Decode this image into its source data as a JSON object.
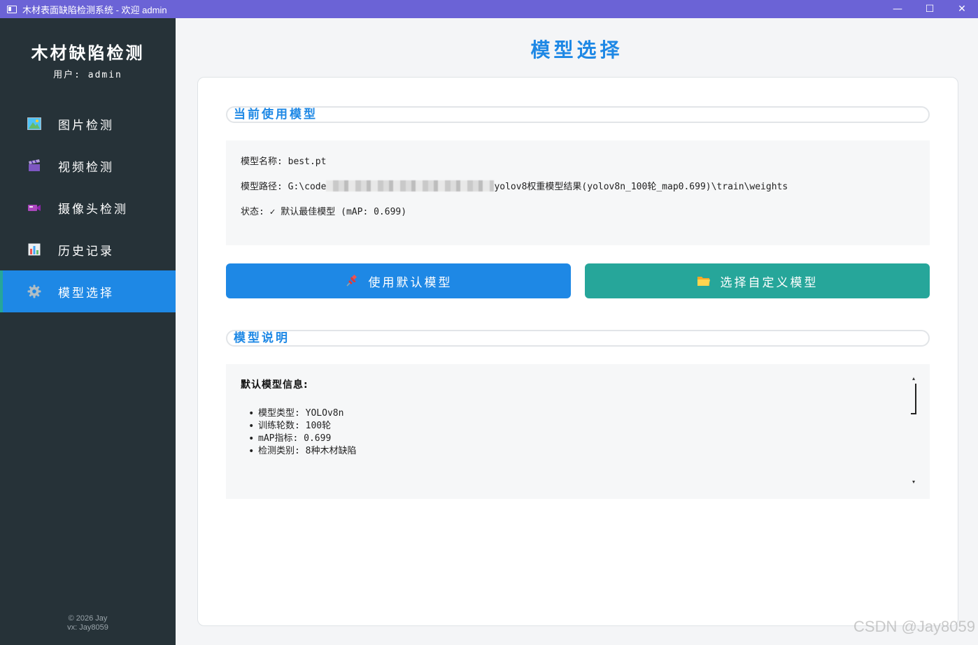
{
  "window": {
    "title": "木材表面缺陷检测系统 - 欢迎 admin",
    "minimize": "—",
    "maximize": "☐",
    "close": "✕"
  },
  "sidebar": {
    "brand": "木材缺陷检测",
    "user": "用户: admin",
    "items": [
      {
        "label": "图片检测",
        "icon": "image-icon"
      },
      {
        "label": "视频检测",
        "icon": "clapperboard-icon"
      },
      {
        "label": "摄像头检测",
        "icon": "video-camera-icon"
      },
      {
        "label": "历史记录",
        "icon": "bar-chart-icon"
      },
      {
        "label": "模型选择",
        "icon": "gear-icon",
        "active": true
      }
    ],
    "footer_line1": "© 2026 Jay",
    "footer_line2": "vx: Jay8059"
  },
  "main": {
    "page_title": "模型选择",
    "current_section": "当前使用模型",
    "model_name_label": "模型名称: ",
    "model_name": "best.pt",
    "model_path_label": "模型路径: ",
    "model_path_prefix": "G:\\code",
    "model_path_suffix": "yolov8权重模型结果(yolov8n_100轮_map0.699)\\train\\weights",
    "status_label": "状态: ",
    "status_value": "✓ 默认最佳模型 (mAP: 0.699)",
    "btn_default": "使用默认模型",
    "btn_custom": "选择自定义模型",
    "desc_section": "模型说明",
    "desc_title": "默认模型信息:",
    "desc_items": [
      "模型类型: YOLOv8n",
      "训练轮数: 100轮",
      "mAP指标: 0.699",
      "检测类别: 8种木材缺陷"
    ]
  },
  "watermark": "CSDN @Jay8059",
  "colors": {
    "primary": "#1e88e5",
    "teal": "#26a69a",
    "sidebar": "#263238",
    "titlebar": "#6b63d6"
  }
}
